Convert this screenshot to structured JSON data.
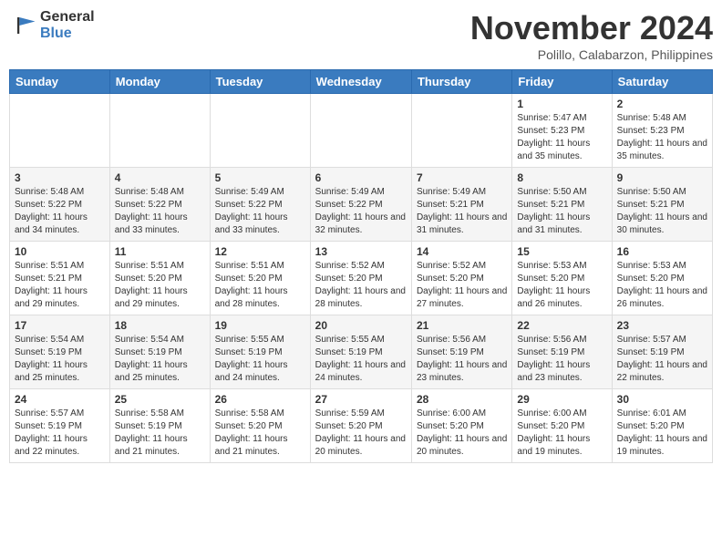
{
  "logo": {
    "general": "General",
    "blue": "Blue"
  },
  "title": "November 2024",
  "location": "Polillo, Calabarzon, Philippines",
  "weekdays": [
    "Sunday",
    "Monday",
    "Tuesday",
    "Wednesday",
    "Thursday",
    "Friday",
    "Saturday"
  ],
  "weeks": [
    [
      {
        "day": "",
        "detail": ""
      },
      {
        "day": "",
        "detail": ""
      },
      {
        "day": "",
        "detail": ""
      },
      {
        "day": "",
        "detail": ""
      },
      {
        "day": "",
        "detail": ""
      },
      {
        "day": "1",
        "detail": "Sunrise: 5:47 AM\nSunset: 5:23 PM\nDaylight: 11 hours\nand 35 minutes."
      },
      {
        "day": "2",
        "detail": "Sunrise: 5:48 AM\nSunset: 5:23 PM\nDaylight: 11 hours\nand 35 minutes."
      }
    ],
    [
      {
        "day": "3",
        "detail": "Sunrise: 5:48 AM\nSunset: 5:22 PM\nDaylight: 11 hours\nand 34 minutes."
      },
      {
        "day": "4",
        "detail": "Sunrise: 5:48 AM\nSunset: 5:22 PM\nDaylight: 11 hours\nand 33 minutes."
      },
      {
        "day": "5",
        "detail": "Sunrise: 5:49 AM\nSunset: 5:22 PM\nDaylight: 11 hours\nand 33 minutes."
      },
      {
        "day": "6",
        "detail": "Sunrise: 5:49 AM\nSunset: 5:22 PM\nDaylight: 11 hours\nand 32 minutes."
      },
      {
        "day": "7",
        "detail": "Sunrise: 5:49 AM\nSunset: 5:21 PM\nDaylight: 11 hours\nand 31 minutes."
      },
      {
        "day": "8",
        "detail": "Sunrise: 5:50 AM\nSunset: 5:21 PM\nDaylight: 11 hours\nand 31 minutes."
      },
      {
        "day": "9",
        "detail": "Sunrise: 5:50 AM\nSunset: 5:21 PM\nDaylight: 11 hours\nand 30 minutes."
      }
    ],
    [
      {
        "day": "10",
        "detail": "Sunrise: 5:51 AM\nSunset: 5:21 PM\nDaylight: 11 hours\nand 29 minutes."
      },
      {
        "day": "11",
        "detail": "Sunrise: 5:51 AM\nSunset: 5:20 PM\nDaylight: 11 hours\nand 29 minutes."
      },
      {
        "day": "12",
        "detail": "Sunrise: 5:51 AM\nSunset: 5:20 PM\nDaylight: 11 hours\nand 28 minutes."
      },
      {
        "day": "13",
        "detail": "Sunrise: 5:52 AM\nSunset: 5:20 PM\nDaylight: 11 hours\nand 28 minutes."
      },
      {
        "day": "14",
        "detail": "Sunrise: 5:52 AM\nSunset: 5:20 PM\nDaylight: 11 hours\nand 27 minutes."
      },
      {
        "day": "15",
        "detail": "Sunrise: 5:53 AM\nSunset: 5:20 PM\nDaylight: 11 hours\nand 26 minutes."
      },
      {
        "day": "16",
        "detail": "Sunrise: 5:53 AM\nSunset: 5:20 PM\nDaylight: 11 hours\nand 26 minutes."
      }
    ],
    [
      {
        "day": "17",
        "detail": "Sunrise: 5:54 AM\nSunset: 5:19 PM\nDaylight: 11 hours\nand 25 minutes."
      },
      {
        "day": "18",
        "detail": "Sunrise: 5:54 AM\nSunset: 5:19 PM\nDaylight: 11 hours\nand 25 minutes."
      },
      {
        "day": "19",
        "detail": "Sunrise: 5:55 AM\nSunset: 5:19 PM\nDaylight: 11 hours\nand 24 minutes."
      },
      {
        "day": "20",
        "detail": "Sunrise: 5:55 AM\nSunset: 5:19 PM\nDaylight: 11 hours\nand 24 minutes."
      },
      {
        "day": "21",
        "detail": "Sunrise: 5:56 AM\nSunset: 5:19 PM\nDaylight: 11 hours\nand 23 minutes."
      },
      {
        "day": "22",
        "detail": "Sunrise: 5:56 AM\nSunset: 5:19 PM\nDaylight: 11 hours\nand 23 minutes."
      },
      {
        "day": "23",
        "detail": "Sunrise: 5:57 AM\nSunset: 5:19 PM\nDaylight: 11 hours\nand 22 minutes."
      }
    ],
    [
      {
        "day": "24",
        "detail": "Sunrise: 5:57 AM\nSunset: 5:19 PM\nDaylight: 11 hours\nand 22 minutes."
      },
      {
        "day": "25",
        "detail": "Sunrise: 5:58 AM\nSunset: 5:19 PM\nDaylight: 11 hours\nand 21 minutes."
      },
      {
        "day": "26",
        "detail": "Sunrise: 5:58 AM\nSunset: 5:20 PM\nDaylight: 11 hours\nand 21 minutes."
      },
      {
        "day": "27",
        "detail": "Sunrise: 5:59 AM\nSunset: 5:20 PM\nDaylight: 11 hours\nand 20 minutes."
      },
      {
        "day": "28",
        "detail": "Sunrise: 6:00 AM\nSunset: 5:20 PM\nDaylight: 11 hours\nand 20 minutes."
      },
      {
        "day": "29",
        "detail": "Sunrise: 6:00 AM\nSunset: 5:20 PM\nDaylight: 11 hours\nand 19 minutes."
      },
      {
        "day": "30",
        "detail": "Sunrise: 6:01 AM\nSunset: 5:20 PM\nDaylight: 11 hours\nand 19 minutes."
      }
    ]
  ]
}
